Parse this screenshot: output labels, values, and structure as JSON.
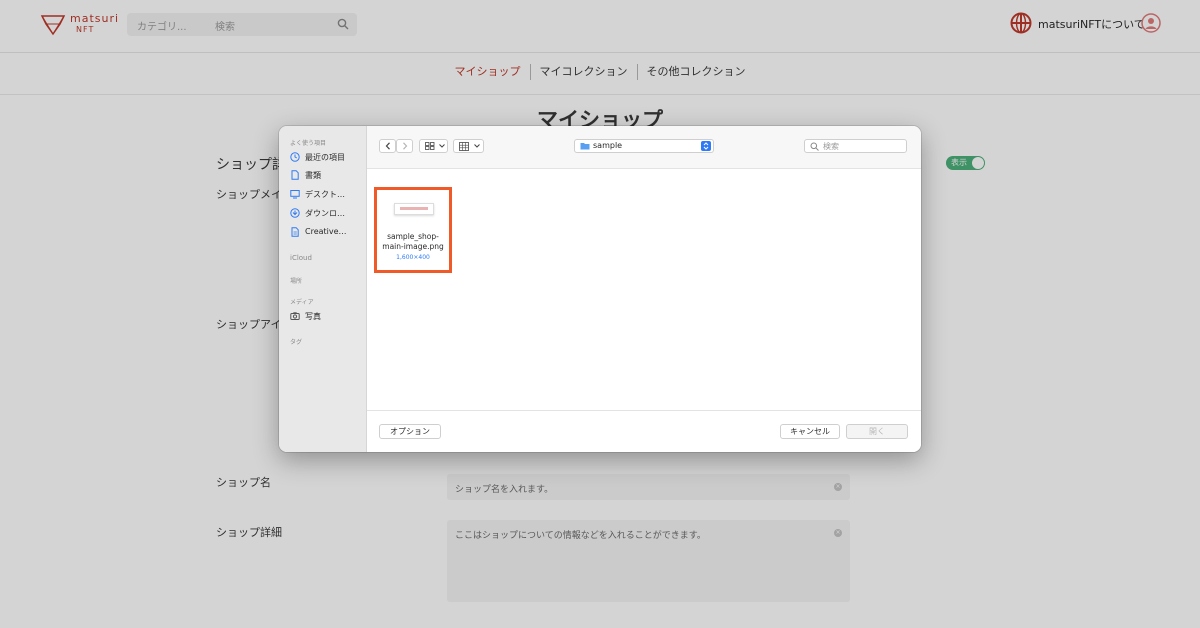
{
  "header": {
    "logo_text": "matsuri",
    "logo_sub": "NFT",
    "search_category": "カテゴリ...",
    "search_placeholder": "検索",
    "about_label": "matsuriNFTについて"
  },
  "nav": {
    "tabs": [
      {
        "label": "マイショップ",
        "active": true
      },
      {
        "label": "マイコレクション",
        "active": false
      },
      {
        "label": "その他コレクション",
        "active": false
      }
    ]
  },
  "page": {
    "title": "マイショップ",
    "section_title": "ショップ詳",
    "toggle_label": "表示",
    "rows": {
      "main_image_label": "ショップメイ",
      "icon_label": "ショップアイ",
      "name_label": "ショップ名",
      "name_placeholder": "ショップ名を入れます。",
      "detail_label": "ショップ詳細",
      "detail_placeholder": "ここはショップについての情報などを入れることができます。"
    }
  },
  "dialog": {
    "sidebar": {
      "favorites_heading": "よく使う項目",
      "favorites": [
        {
          "label": "最近の項目",
          "icon": "clock-icon"
        },
        {
          "label": "書類",
          "icon": "document-icon"
        },
        {
          "label": "デスクト…",
          "icon": "desktop-icon"
        },
        {
          "label": "ダウンロ…",
          "icon": "download-icon"
        },
        {
          "label": "Creative…",
          "icon": "file-icon"
        }
      ],
      "icloud_heading": "iCloud",
      "locations_heading": "場所",
      "media_heading": "メディア",
      "media": [
        {
          "label": "写真",
          "icon": "camera-icon"
        }
      ],
      "tags_heading": "タグ"
    },
    "toolbar": {
      "folder_name": "sample",
      "search_placeholder": "検索"
    },
    "file": {
      "name_line1": "sample_shop-",
      "name_line2": "main-image.png",
      "size": "1,600×400"
    },
    "footer": {
      "options_label": "オプション",
      "cancel_label": "キャンセル",
      "open_label": "開く"
    }
  },
  "colors": {
    "brand": "#c0392b",
    "highlight": "#ef5a28",
    "toggle": "#4bb07a",
    "accent": "#2f7bf5"
  }
}
